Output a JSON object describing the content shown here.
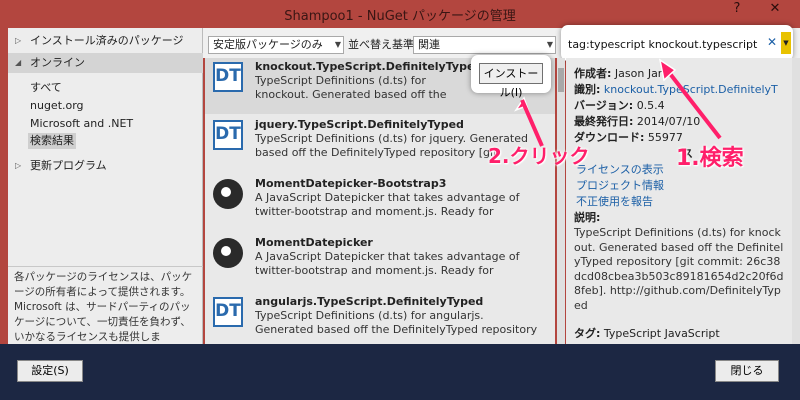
{
  "window": {
    "title": "Shampoo1 - NuGet パッケージの管理",
    "help": "?",
    "close": "✕"
  },
  "left": {
    "installed": "インストール済みのパッケージ",
    "online": "オンライン",
    "sub_all": "すべて",
    "sub_nuget": "nuget.org",
    "sub_ms": "Microsoft and .NET",
    "sub_results": "検索結果",
    "updates": "更新プログラム",
    "license_note": "各パッケージのライセンスは、パッケージの所有者によって提供されます。Microsoft は、サードパーティのパッケージについて、一切責任を負わず、いかなるライセンスも提供しま"
  },
  "toolbar": {
    "filter_value": "安定版パッケージのみ",
    "sort_label": "並べ替え基準:",
    "sort_value": "関連"
  },
  "search": {
    "value": "tag:typescript knockout.typescript"
  },
  "packages": [
    {
      "name": "knockout.TypeScript.DefinitelyTyped",
      "desc": "TypeScript Definitions (d.ts) for knockout. Generated based off the DefinitelyType",
      "icon": "DT"
    },
    {
      "name": "jquery.TypeScript.DefinitelyTyped",
      "desc": "TypeScript Definitions (d.ts) for jquery. Generated based off the DefinitelyTyped repository [git commit: c",
      "icon": "DT"
    },
    {
      "name": "MomentDatepicker-Bootstrap3",
      "desc": "A JavaScript Datepicker that takes advantage of twitter-bootstrap and moment.js. Ready for TypeScrip",
      "icon": ""
    },
    {
      "name": "MomentDatepicker",
      "desc": "A JavaScript Datepicker that takes advantage of twitter-bootstrap and moment.js. Ready for TypeScrip",
      "icon": ""
    },
    {
      "name": "angularjs.TypeScript.DefinitelyTyped",
      "desc": "TypeScript Definitions (d.ts) for angularjs. Generated based off the DefinitelyTyped repository [git commit:",
      "icon": "DT"
    }
  ],
  "install_label": "インストール(I)",
  "details": {
    "author_label": "作成者:",
    "author_value": "Jason Jarr",
    "id_label": "識別:",
    "id_value": "knockout.TypeScript.DefinitelyT",
    "version_label": "バージョン:",
    "version_value": "0.5.4",
    "pub_label": "最終発行日:",
    "pub_value": "2014/07/10",
    "dl_label": "ダウンロード:",
    "dl_value": "55977",
    "lic_label": "ス",
    "lic_link": "ライセンスの表示",
    "proj_link": "プロジェクト情報",
    "abuse_link": "不正使用を報告",
    "desc_label": "説明:",
    "desc": "TypeScript Definitions (d.ts) for knockout. Generated based off the DefinitelyTyped repository [git commit: 26c38dcd08cbea3b503c89181654d2c20f6d8feb]. http://github.com/DefinitelyTyped",
    "tags_label": "タグ:",
    "tags_value": "TypeScript JavaScript"
  },
  "bottom": {
    "settings": "設定(S)",
    "close": "閉じる"
  },
  "annotations": {
    "click": "2.クリック",
    "search": "1.検索"
  },
  "colors": {
    "title_bar": "#b3463f",
    "accent_annotation": "#ff1f6a",
    "link": "#1b5fa6",
    "bottom_bar": "#1c2743"
  }
}
